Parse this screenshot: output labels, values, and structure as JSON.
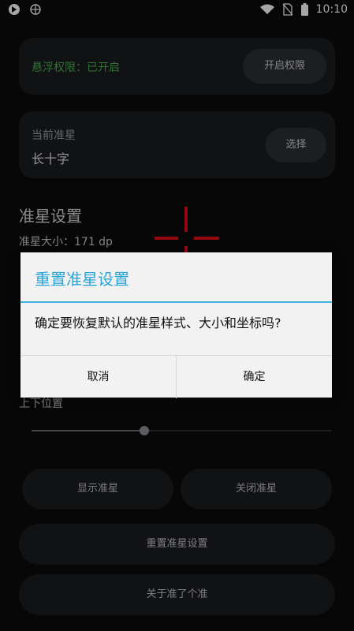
{
  "status_bar": {
    "time": "10:10"
  },
  "permission_card": {
    "label": "悬浮权限：已开启",
    "button": "开启权限",
    "label_color": "#4caf50"
  },
  "crosshair_card": {
    "label": "当前准星",
    "value": "长十字",
    "button": "选择"
  },
  "settings": {
    "title": "准星设置",
    "size_label": "准星大小：171 dp",
    "position_label": "上下位置",
    "slider_value_fraction": 0.38
  },
  "buttons": {
    "show": "显示准星",
    "close": "关闭准星",
    "reset": "重置准星设置",
    "about": "关于准了个准"
  },
  "crosshair_overlay": {
    "color": "#e30d1a",
    "shape": "long-cross"
  },
  "dialog": {
    "title": "重置准星设置",
    "message": "确定要恢复默认的准星样式、大小和坐标吗?",
    "cancel": "取消",
    "confirm": "确定",
    "accent_color": "#2aa5d8"
  }
}
